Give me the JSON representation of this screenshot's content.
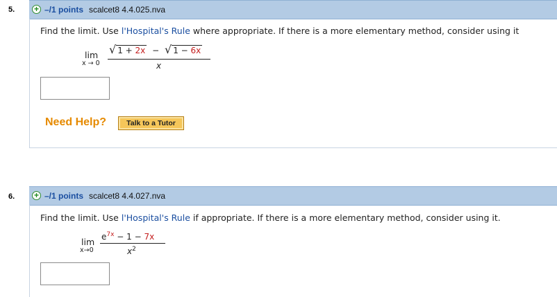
{
  "q5": {
    "number": "5.",
    "plus_icon": "+",
    "points": "–/1 points",
    "source": "scalcet8 4.4.025.nva",
    "prompt_before": "Find the limit. Use ",
    "prompt_link": "l'Hospital's Rule",
    "prompt_after": " where appropriate. If there is a more elementary method, consider using it",
    "lim": "lim",
    "lim_sub": "x → 0",
    "sqrt": "√",
    "num_a_1": "1 + ",
    "num_a_2": "2x",
    "minus": "−",
    "num_b_1": "1 − ",
    "num_b_2": "6x",
    "denominator": "x",
    "answer_value": "",
    "need_help": "Need Help?",
    "tutor_button": "Talk to a Tutor"
  },
  "q6": {
    "number": "6.",
    "plus_icon": "+",
    "points": "–/1 points",
    "source": "scalcet8 4.4.027.nva",
    "prompt_before": "Find the limit. Use ",
    "prompt_link": "l'Hospital's Rule",
    "prompt_after": " if appropriate. If there is a more elementary method, consider using it.",
    "lim": "lim",
    "lim_sub": "x→0",
    "e": "e",
    "exp": "7x",
    "num_rest": " − 1 − ",
    "num_red": "7x",
    "den_base": "x",
    "den_exp": "2",
    "answer_value": ""
  },
  "colors": {
    "header_bg": "#b3cbe4",
    "points_blue": "#1a4ea0",
    "help_orange": "#e68a00",
    "tutor_gold": "#f5c65a",
    "math_red": "#c41e1e"
  }
}
